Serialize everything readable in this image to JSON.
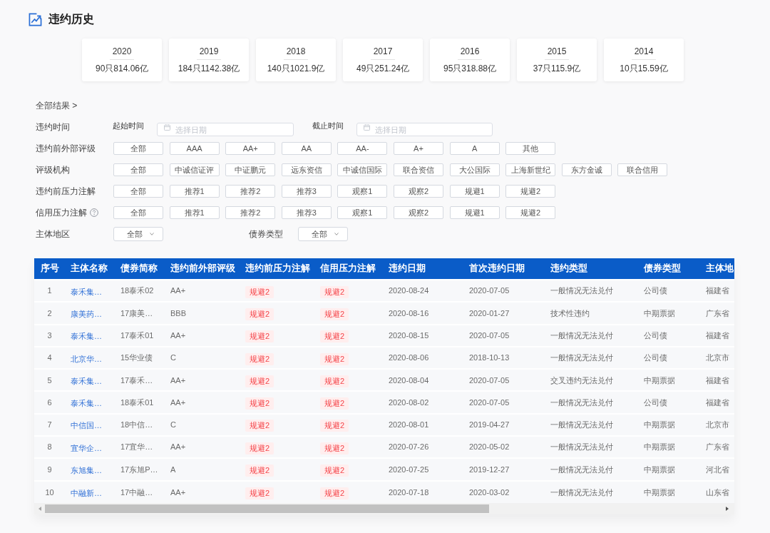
{
  "header": {
    "title": "违约历史"
  },
  "year_summary": [
    {
      "year": "2020",
      "total": "90只814.06亿"
    },
    {
      "year": "2019",
      "total": "184只1142.38亿"
    },
    {
      "year": "2018",
      "total": "140只1021.9亿"
    },
    {
      "year": "2017",
      "total": "49只251.24亿"
    },
    {
      "year": "2016",
      "total": "95只318.88亿"
    },
    {
      "year": "2015",
      "total": "37只115.9亿"
    },
    {
      "year": "2014",
      "total": "10只15.59亿"
    }
  ],
  "filters": {
    "breadcrumb": "全部结果 >",
    "date_range": {
      "label": "违约时间",
      "start": {
        "label": "起始时间",
        "placeholder": "选择日期"
      },
      "end": {
        "label": "截止时间",
        "placeholder": "选择日期"
      }
    },
    "chip_groups": [
      {
        "label": "违约前外部评级",
        "options": [
          "全部",
          "AAA",
          "AA+",
          "AA",
          "AA-",
          "A+",
          "A",
          "其他"
        ]
      },
      {
        "label": "评级机构",
        "options": [
          "全部",
          "中诚信证评",
          "中证鹏元",
          "远东资信",
          "中诚信国际",
          "联合资信",
          "大公国际",
          "上海新世纪",
          "东方金诚",
          "联合信用"
        ]
      },
      {
        "label": "违约前压力注解",
        "options": [
          "全部",
          "推荐1",
          "推荐2",
          "推荐3",
          "观察1",
          "观察2",
          "规避1",
          "规避2"
        ]
      },
      {
        "label": "信用压力注解",
        "help": true,
        "options": [
          "全部",
          "推荐1",
          "推荐2",
          "推荐3",
          "观察1",
          "观察2",
          "规避1",
          "规避2"
        ]
      }
    ],
    "selects": [
      {
        "label": "主体地区",
        "value": "全部"
      },
      {
        "label": "债券类型",
        "value": "全部"
      }
    ]
  },
  "table": {
    "columns": [
      {
        "label": "序号",
        "kind": "index"
      },
      {
        "label": "主体名称",
        "kind": "link"
      },
      {
        "label": "债券简称",
        "kind": "text"
      },
      {
        "label": "违约前外部评级",
        "kind": "text"
      },
      {
        "label": "违约前压力注解",
        "kind": "tag"
      },
      {
        "label": "信用压力注解",
        "kind": "tag"
      },
      {
        "label": "违约日期",
        "kind": "text"
      },
      {
        "label": "首次违约日期",
        "kind": "text"
      },
      {
        "label": "违约类型",
        "kind": "text"
      },
      {
        "label": "债券类型",
        "kind": "text"
      },
      {
        "label": "主体地",
        "kind": "text"
      }
    ],
    "rows": [
      [
        "1",
        "泰禾集…",
        "18泰禾02",
        "AA+",
        "规避2",
        "规避2",
        "2020-08-24",
        "2020-07-05",
        "一般情况无法兑付",
        "公司债",
        "福建省"
      ],
      [
        "2",
        "康美药…",
        "17康美…",
        "BBB",
        "规避2",
        "规避2",
        "2020-08-16",
        "2020-01-27",
        "技术性违约",
        "中期票据",
        "广东省"
      ],
      [
        "3",
        "泰禾集…",
        "17泰禾01",
        "AA+",
        "规避2",
        "规避2",
        "2020-08-15",
        "2020-07-05",
        "一般情况无法兑付",
        "公司债",
        "福建省"
      ],
      [
        "4",
        "北京华…",
        "15华业债",
        "C",
        "规避2",
        "规避2",
        "2020-08-06",
        "2018-10-13",
        "一般情况无法兑付",
        "公司债",
        "北京市"
      ],
      [
        "5",
        "泰禾集…",
        "17泰禾…",
        "AA+",
        "规避2",
        "规避2",
        "2020-08-04",
        "2020-07-05",
        "交叉违约无法兑付",
        "中期票据",
        "福建省"
      ],
      [
        "6",
        "泰禾集…",
        "18泰禾01",
        "AA+",
        "规避2",
        "规避2",
        "2020-08-02",
        "2020-07-05",
        "一般情况无法兑付",
        "公司债",
        "福建省"
      ],
      [
        "7",
        "中信国…",
        "18中信…",
        "C",
        "规避2",
        "规避2",
        "2020-08-01",
        "2019-04-27",
        "一般情况无法兑付",
        "中期票据",
        "北京市"
      ],
      [
        "8",
        "宜华企…",
        "17宜华…",
        "AA+",
        "规避2",
        "规避2",
        "2020-07-26",
        "2020-05-02",
        "一般情况无法兑付",
        "中期票据",
        "广东省"
      ],
      [
        "9",
        "东旭集…",
        "17东旭P…",
        "A",
        "规避2",
        "规避2",
        "2020-07-25",
        "2019-12-27",
        "一般情况无法兑付",
        "中期票据",
        "河北省"
      ],
      [
        "10",
        "中融新…",
        "17中融…",
        "AA+",
        "规避2",
        "规避2",
        "2020-07-18",
        "2020-03-02",
        "一般情况无法兑付",
        "中期票据",
        "山东省"
      ]
    ]
  }
}
